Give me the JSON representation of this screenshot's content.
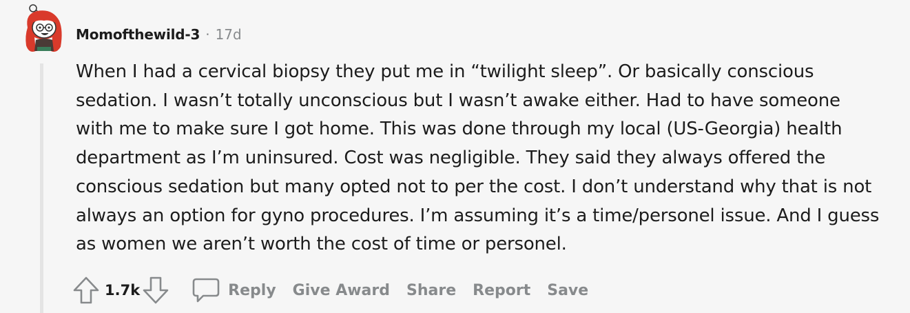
{
  "comment": {
    "author": "Momofthewild-3",
    "separator": "·",
    "age": "17d",
    "body": "When I had a cervical biopsy they put me in “twilight sleep”. Or basically conscious sedation. I wasn’t totally unconscious but I wasn’t awake either. Had to have someone with me to make sure I got home. This was done through my local (US-Georgia) health department as I’m uninsured. Cost was negligible. They said they always offered the conscious sedation but many opted not to per the cost. I don’t understand why that is not always an option for gyno procedures. I’m assuming it’s a time/personel issue. And I guess as women we aren’t worth the cost of time or personel.",
    "votes": "1.7k"
  },
  "actions": {
    "reply": "Reply",
    "give_award": "Give Award",
    "share": "Share",
    "report": "Report",
    "save": "Save"
  },
  "icons": {
    "upvote": "upvote-arrow-icon",
    "downvote": "downvote-arrow-icon",
    "reply": "speech-bubble-icon"
  },
  "colors": {
    "background": "#f6f6f6",
    "text": "#1c1c1c",
    "meta": "#878a8c",
    "thread_line": "#e4e4e4",
    "avatar_hair": "#d93a2b"
  }
}
